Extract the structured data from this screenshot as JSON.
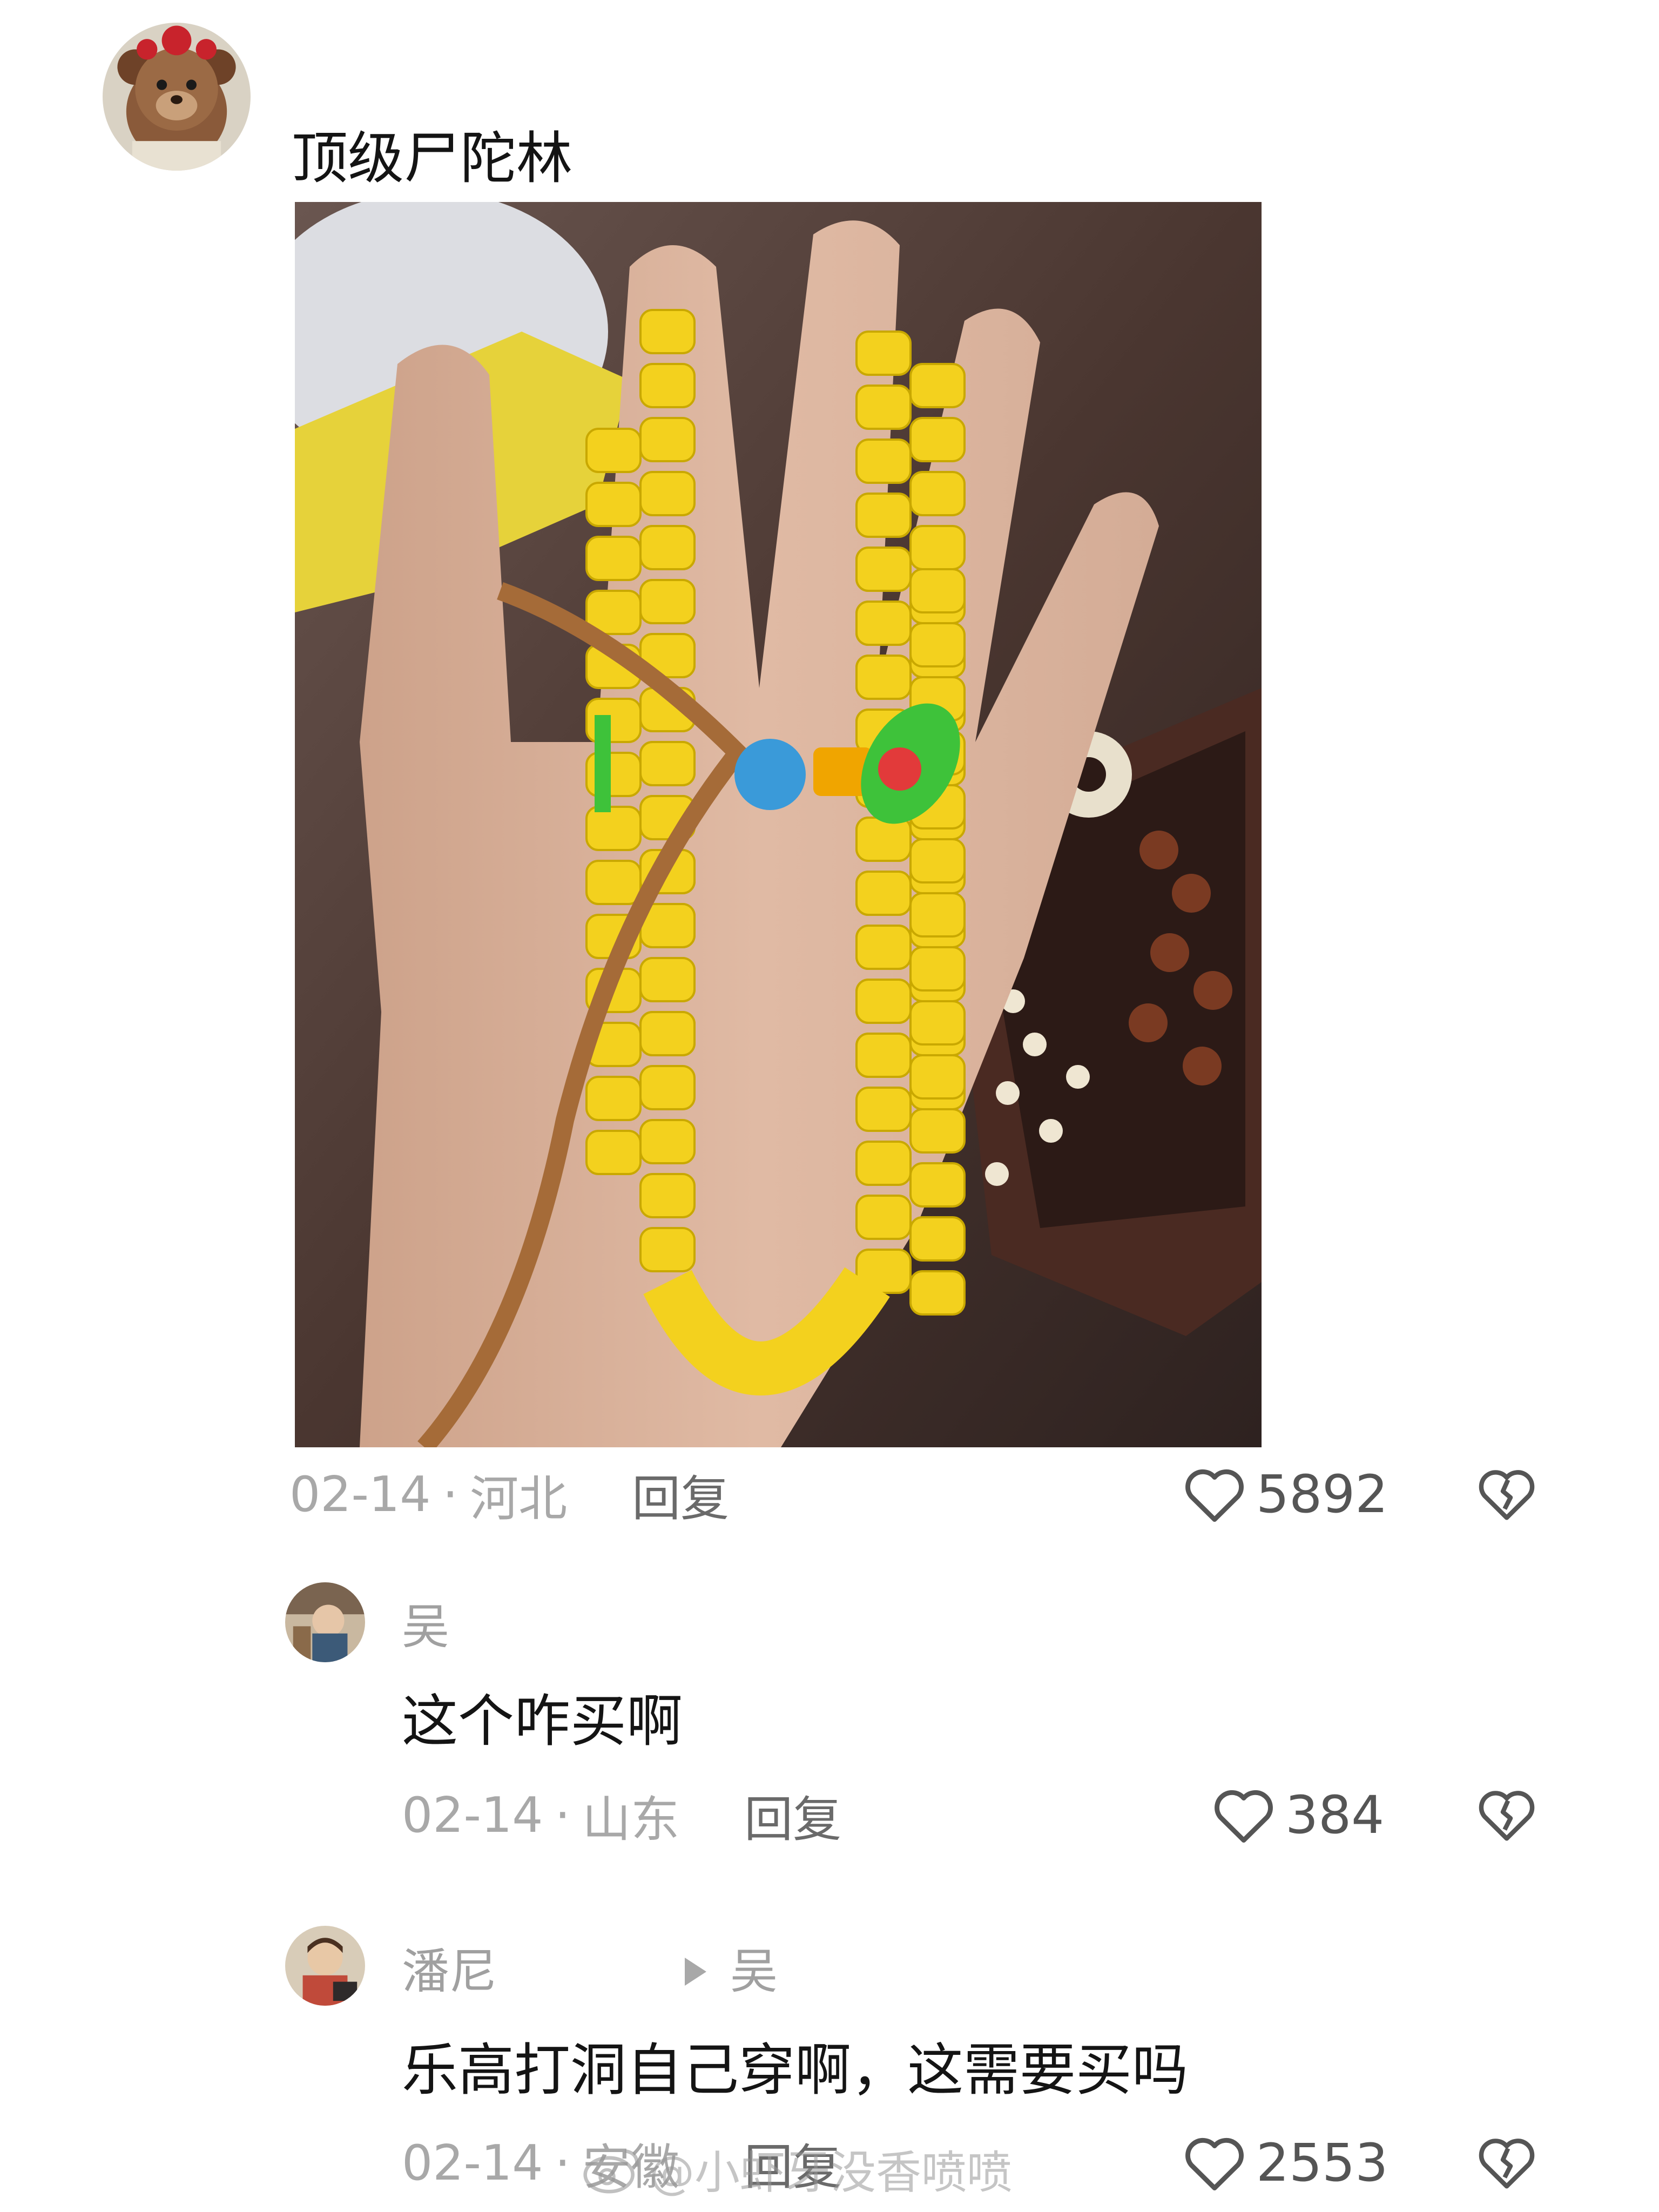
{
  "post": {
    "text": "顶级尸陀林",
    "date": "02-14",
    "location": "河北",
    "reply_label": "回复",
    "likes": "5892"
  },
  "replies": [
    {
      "username": "吴",
      "text": "这个咋买啊",
      "date": "02-14",
      "location": "山东",
      "reply_label": "回复",
      "likes": "384"
    },
    {
      "username": "潘尼",
      "reply_to": "吴",
      "text": "乐高打洞自己穿啊，这需要买吗",
      "date": "02-14",
      "location": "安徽",
      "reply_label": "回复",
      "likes": "2553"
    }
  ],
  "meta_separator": "·",
  "watermark": "@小虾牙没香喷喷",
  "icons": {
    "like": "heart-outline-icon",
    "dislike": "broken-heart-icon",
    "reply_arrow": "triangle-right-icon",
    "watermark": "weibo-logo-icon"
  }
}
